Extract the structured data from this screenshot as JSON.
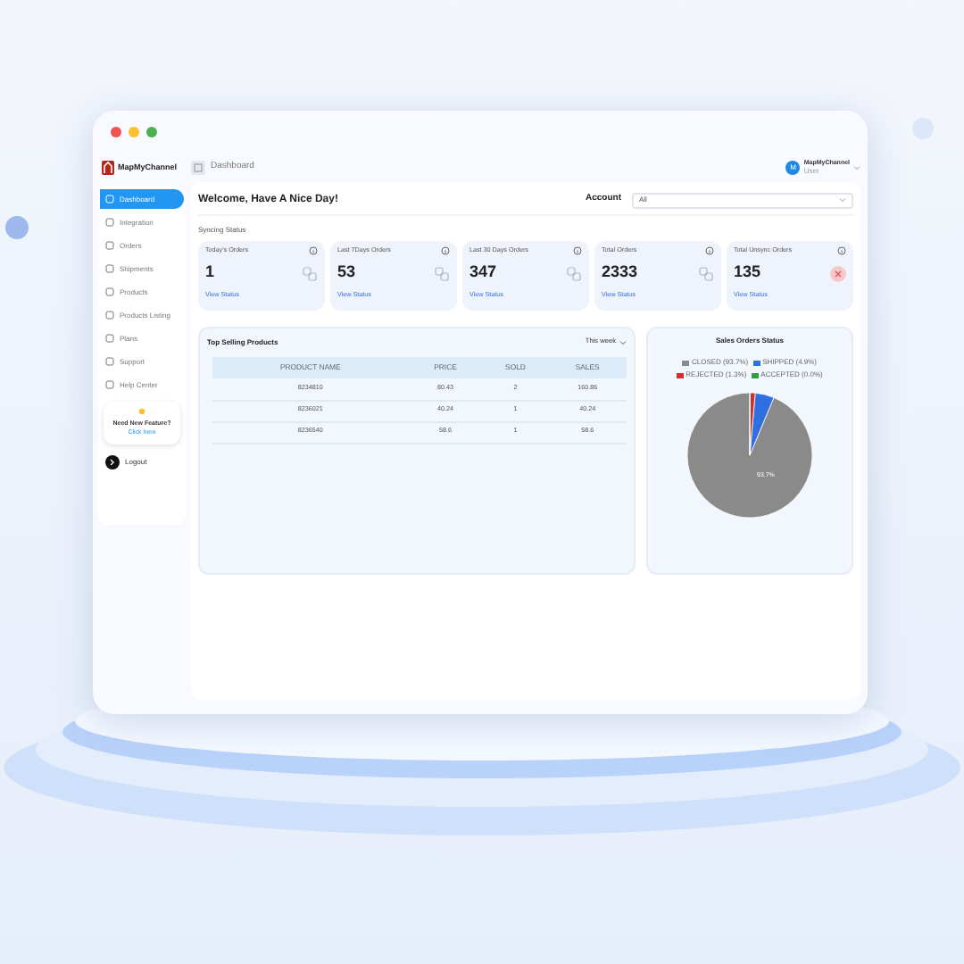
{
  "window": {
    "controls": [
      {
        "color": "#ef5350"
      },
      {
        "color": "#fbc02d"
      },
      {
        "color": "#4caf50"
      }
    ]
  },
  "sidebar": {
    "brand": "MapMyChannel",
    "items": [
      {
        "label": "Dashboard",
        "selected": true
      },
      {
        "label": "Integration",
        "selected": false
      },
      {
        "label": "Orders",
        "selected": false
      },
      {
        "label": "Shipments",
        "selected": false
      },
      {
        "label": "Products",
        "selected": false
      },
      {
        "label": "Products Listing",
        "selected": false
      },
      {
        "label": "Plans",
        "selected": false
      },
      {
        "label": "Support",
        "selected": false
      },
      {
        "label": "Help Center",
        "selected": false
      }
    ],
    "promo": {
      "title": "Need New Feature?",
      "link": "Click here"
    },
    "logout": "Logout"
  },
  "header": {
    "page": "Dashboard",
    "user": {
      "initials": "M",
      "name": "MapMyChannel",
      "role": "User"
    }
  },
  "welcome": "Welcome, Have A Nice Day!",
  "account": {
    "label": "Account",
    "value": "All"
  },
  "syncing": {
    "title": "Syncing Status",
    "cards": [
      {
        "label": "Today's Orders",
        "value": "1",
        "link": "View Status",
        "kind": "plain"
      },
      {
        "label": "Last 7Days Orders",
        "value": "53",
        "link": "View Status",
        "kind": "plain"
      },
      {
        "label": "Last 30 Days Orders",
        "value": "347",
        "link": "View Status",
        "kind": "plain"
      },
      {
        "label": "Total Orders",
        "value": "2333",
        "link": "View Status",
        "kind": "plain"
      },
      {
        "label": "Total Unsync Orders",
        "value": "135",
        "link": "View Status",
        "kind": "alert"
      }
    ]
  },
  "top_selling": {
    "title": "Top Selling Products",
    "period": "This week",
    "columns": [
      "PRODUCT NAME",
      "PRICE",
      "SOLD",
      "SALES"
    ],
    "rows": [
      [
        "8234810",
        "80.43",
        "2",
        "160.86"
      ],
      [
        "8236021",
        "40.24",
        "1",
        "40.24"
      ],
      [
        "8236540",
        "58.6",
        "1",
        "58.6"
      ]
    ]
  },
  "sales_status": {
    "title": "Sales Orders Status",
    "chart_data": {
      "type": "pie",
      "categories": [
        "CLOSED (93.7%)",
        "SHIPPED (4.9%)",
        "REJECTED (1.3%)",
        "ACCEPTED (0.0%)"
      ],
      "values": [
        93.7,
        4.9,
        1.3,
        0.1
      ],
      "colors": [
        "#8a8a8a",
        "#2f6fe0",
        "#d32f2f",
        "#2e9e3a"
      ],
      "annotations": [
        {
          "text": "93.7%"
        }
      ]
    }
  }
}
